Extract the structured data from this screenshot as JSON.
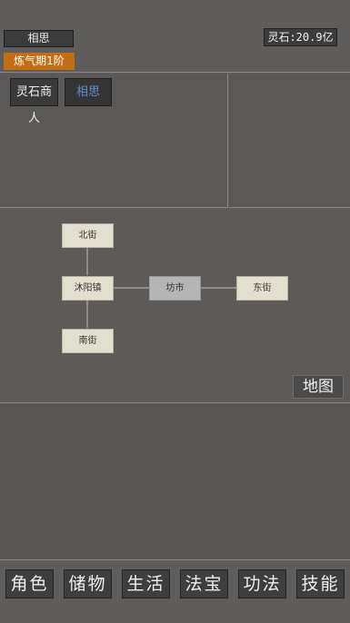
{
  "header": {
    "player_name": "相思",
    "realm": "炼气期1阶",
    "currency": "灵石:20.9亿"
  },
  "scene": {
    "npcs": [
      {
        "label": "灵石商人"
      },
      {
        "label": "相思"
      }
    ]
  },
  "map": {
    "nodes": {
      "north": "北街",
      "town": "沐阳镇",
      "market": "坊市",
      "east": "东街",
      "south": "南街"
    },
    "current": "market",
    "map_button": "地图"
  },
  "bottom_nav": [
    {
      "label": "角色"
    },
    {
      "label": "储物"
    },
    {
      "label": "生活"
    },
    {
      "label": "法宝"
    },
    {
      "label": "功法"
    },
    {
      "label": "技能"
    }
  ],
  "colors": {
    "realm_badge": "#c56d12",
    "selected_npc_text": "#5d8fcf",
    "map_node": "#e3dfcf",
    "map_node_current": "#b5b5b5"
  }
}
